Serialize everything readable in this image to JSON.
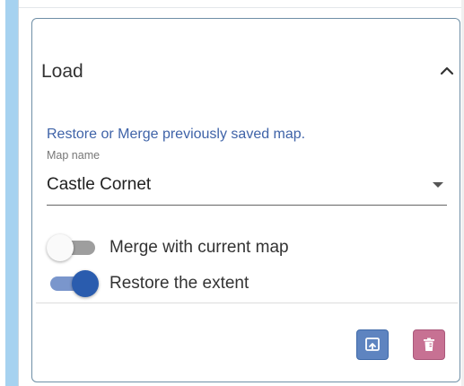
{
  "panel": {
    "title": "Load",
    "description": "Restore or Merge previously saved map.",
    "map_field": {
      "label": "Map name",
      "value": "Castle Cornet"
    },
    "toggles": [
      {
        "label": "Merge with current map",
        "on": false
      },
      {
        "label": "Restore the extent",
        "on": true
      }
    ],
    "actions": {
      "load_icon": "open-map-icon",
      "delete_icon": "delete-map-icon"
    }
  },
  "colors": {
    "accent": "#2a5cae",
    "description_text": "#3f63a8",
    "load_button": "#5e84c0",
    "delete_button": "#c77193",
    "side_strip": "#a6d2f0"
  }
}
